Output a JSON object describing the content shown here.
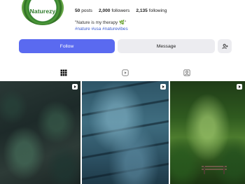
{
  "profile": {
    "avatar_text": "Naturezy",
    "stats": {
      "posts_count": "50",
      "posts_label": "posts",
      "followers_count": "2,000",
      "followers_label": "followers",
      "following_count": "2,135",
      "following_label": "following"
    },
    "bio_line": "\"Nature is my therapy 🌿\"",
    "hashtags": "#nature #usa #naturevibes"
  },
  "actions": {
    "follow_label": "Follow",
    "message_label": "Message",
    "add_icon": "add-person-icon"
  },
  "tabs": [
    {
      "name": "posts",
      "icon": "grid-icon",
      "active": true
    },
    {
      "name": "reels",
      "icon": "reels-icon",
      "active": false
    },
    {
      "name": "tagged",
      "icon": "tagged-icon",
      "active": false
    }
  ],
  "grid": [
    {
      "type": "video",
      "subject": "dark forest floor"
    },
    {
      "type": "video",
      "subject": "blue stone steps"
    },
    {
      "type": "video",
      "subject": "green forest with bench"
    }
  ],
  "colors": {
    "accent": "#5a6af0",
    "hashtag": "#3a5bd0",
    "secondary_button": "#ececf0"
  }
}
